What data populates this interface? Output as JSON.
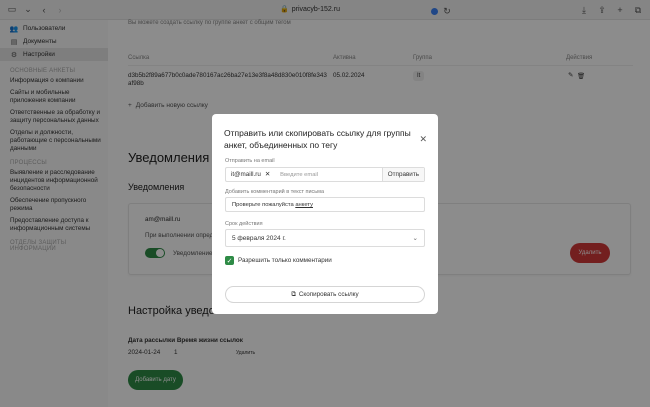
{
  "browser": {
    "url": "privacyb-152.ru"
  },
  "sidebar": {
    "items": [
      {
        "label": "Пользователи",
        "icon": "users-icon"
      },
      {
        "label": "Документы",
        "icon": "document-icon"
      },
      {
        "label": "Настройки",
        "icon": "gear-icon",
        "active": true
      }
    ],
    "sections": [
      {
        "title": "ОСНОВНЫЕ АНКЕТЫ",
        "links": [
          "Информация о компании",
          "Сайты и мобильные приложения компании",
          "Ответственные за обработку и защиту персональных данных",
          "Отделы и должности, работающие с персональными данными"
        ]
      },
      {
        "title": "ПРОЦЕССЫ",
        "links": [
          "Выявление и расследование инцидентов информационной безопасности",
          "Обеспечение пропускного режима",
          "Предоставление доступа к информационным системы"
        ]
      },
      {
        "title": "ОТДЕЛЫ ЗАЩИТЫ ИНФОРМАЦИИ",
        "links": []
      }
    ]
  },
  "main": {
    "top_note": "Вы можете создать ссылку по группе анкет с общим тегом",
    "table": {
      "headers": [
        "Ссылка",
        "Активна",
        "Группа",
        "Действия"
      ],
      "row": {
        "hash": "d3b5b2f89a677b0c0ade780167ac26ba27e13e3f8a48d830e010f8fe343af98b",
        "date": "05.02.2024",
        "group": "It"
      }
    },
    "add_link": "Добавить новую ссылку",
    "notifications_heading": "Уведомления о",
    "notifications_sub": "Уведомления",
    "card": {
      "email": "am@maill.ru",
      "text": "При выполнении опред",
      "toggle_label": "Уведомление о",
      "delete": "Удалить"
    },
    "settings_heading": "Настройка уведомл",
    "mailing": {
      "col1": "Дата рассылки",
      "col2": "Время жизни ссылок",
      "date": "2024-01-24",
      "days": "1",
      "delete": "Удалить"
    },
    "add_date": "Добавить дату"
  },
  "modal": {
    "title": "Отправить или скопировать ссылку для группы анкет, объединенных по тегу",
    "email_label": "Отправить на email",
    "email_chip": "it@maill.ru",
    "email_placeholder": "Введите email",
    "send": "Отправить",
    "comment_label": "Добавить комментарий в текст письма",
    "comment_prefix": "Проверьте пожалуйста ",
    "comment_link": "анкету",
    "validity_label": "Срок действия",
    "validity_value": "5 февраля 2024 г.",
    "checkbox_label": "Разрешить только комментарии",
    "checkbox_checked": true,
    "copy": "Скопировать ссылку"
  },
  "colors": {
    "accent": "#2e8b46",
    "danger": "#d23a3a"
  }
}
